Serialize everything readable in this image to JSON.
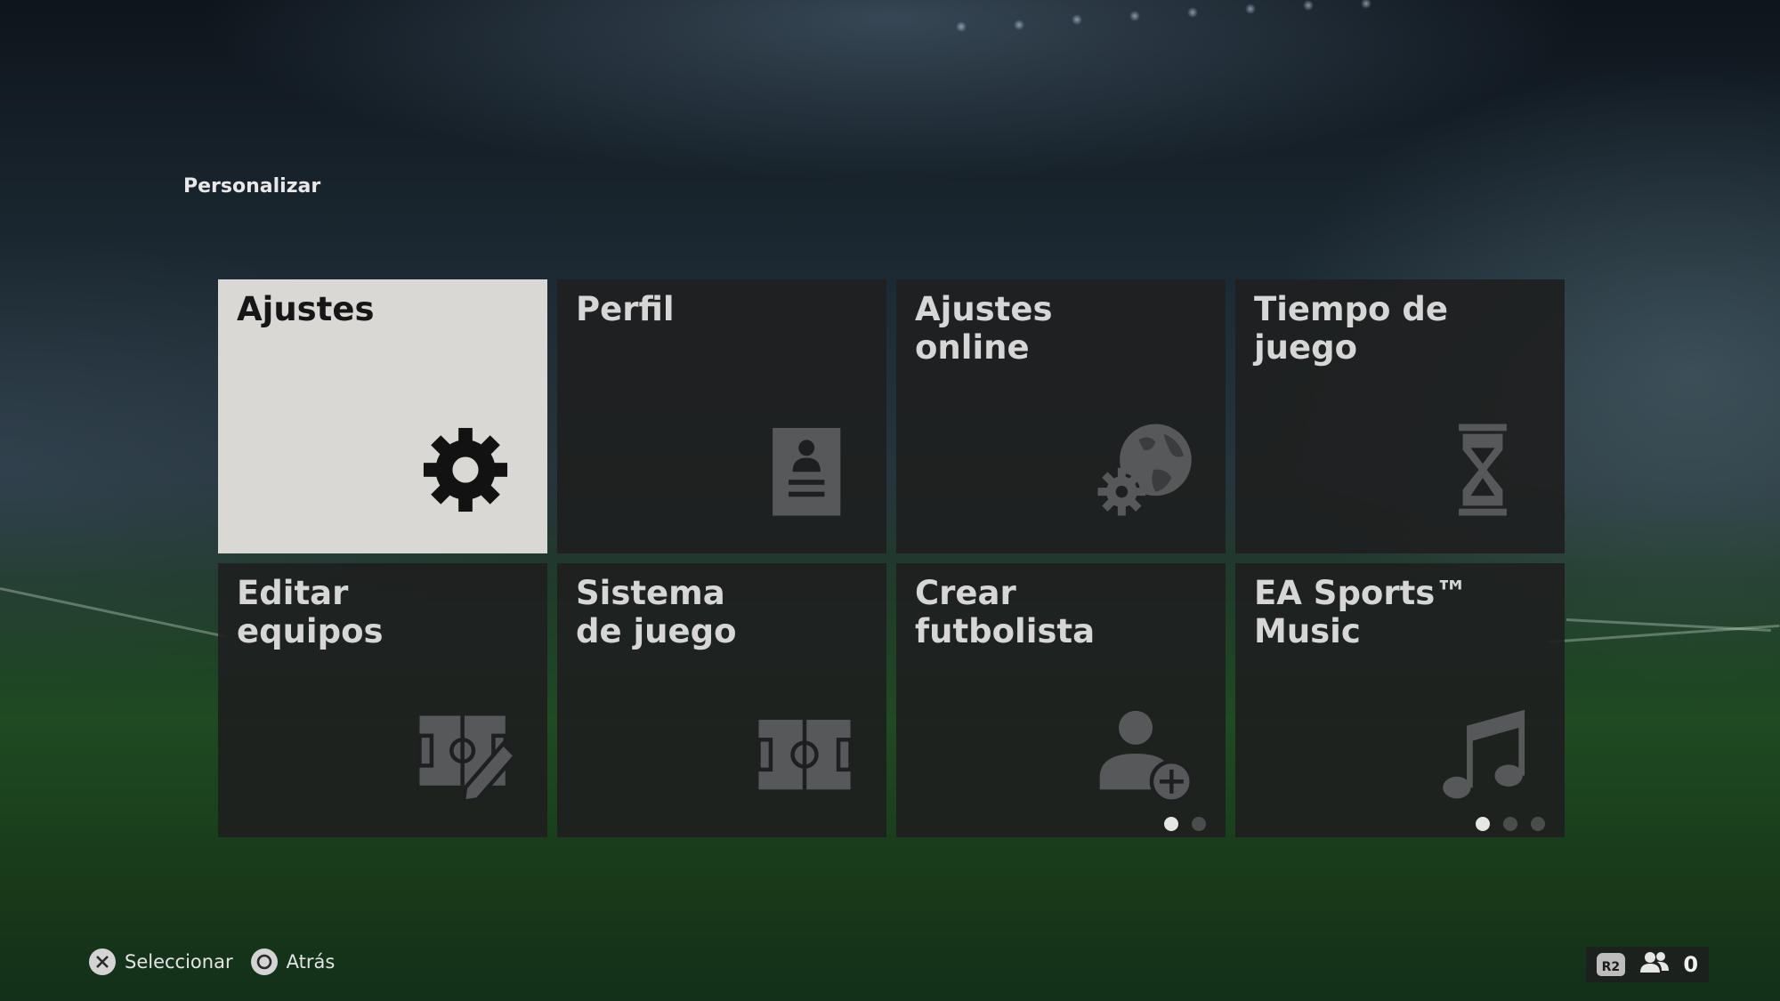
{
  "breadcrumb": "Personalizar",
  "tiles": [
    {
      "label": "Ajustes",
      "icon": "gear-icon",
      "selected": true
    },
    {
      "label": "Perfil",
      "icon": "profile-card-icon"
    },
    {
      "label": "Ajustes\nonline",
      "icon": "globe-gear-icon"
    },
    {
      "label": "Tiempo de juego",
      "icon": "hourglass-icon"
    },
    {
      "label": "Editar\nequipos",
      "icon": "pitch-edit-icon"
    },
    {
      "label": "Sistema\nde juego",
      "icon": "pitch-icon"
    },
    {
      "label": "Crear\nfutbolista",
      "icon": "add-user-icon",
      "page_dots": 2,
      "active_dot": 1
    },
    {
      "label": "EA Sports™\nMusic",
      "icon": "music-note-icon",
      "page_dots": 3,
      "active_dot": 1
    }
  ],
  "footer": {
    "select_label": "Seleccionar",
    "back_label": "Atrás",
    "r2_label": "R2",
    "friends_count": "0"
  },
  "colors": {
    "tile_bg": "#1e1f20",
    "tile_selected_bg": "#d9d8d5",
    "label_color": "#d6d6d6",
    "icon_color": "#555658"
  }
}
